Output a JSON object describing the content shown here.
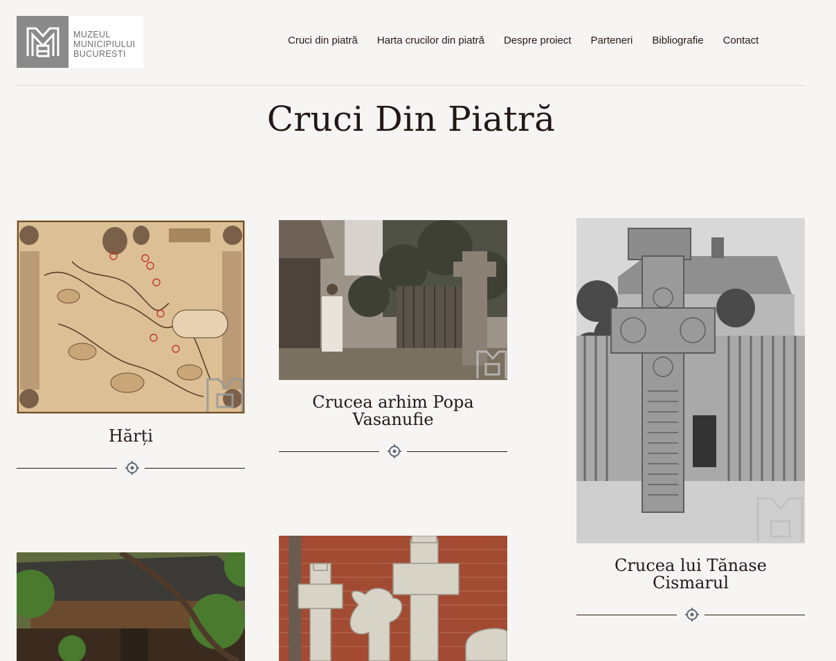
{
  "logo": {
    "line1": "MUZEUL",
    "line2": "MUNICIPIULUI",
    "line3": "BUCURESTI"
  },
  "nav": {
    "items": [
      {
        "label": "Cruci din piatră"
      },
      {
        "label": "Harta crucilor din piatră"
      },
      {
        "label": "Despre proiect"
      },
      {
        "label": "Parteneri"
      },
      {
        "label": "Bibliografie"
      },
      {
        "label": "Contact"
      }
    ]
  },
  "page": {
    "title": "Cruci Din Piatră"
  },
  "cards": [
    {
      "title": "Hărți",
      "image": "map-illustration"
    },
    {
      "title": "Crucea arhim Popa Vasanufie",
      "image": "sepia-photo-woman-and-stone-cross"
    },
    {
      "title": "Crucea lui Tănase Cismarul",
      "image": "bw-photo-stone-cross-fence"
    },
    {
      "title": "",
      "image": "photo-wooden-shelter-trees"
    },
    {
      "title": "",
      "image": "photo-stone-crosses-brick-wall"
    }
  ],
  "colors": {
    "background": "#f7f5f3",
    "text": "#231815",
    "logo_gray": "#8a8a8a",
    "divider_icon": "#5e6a78"
  }
}
